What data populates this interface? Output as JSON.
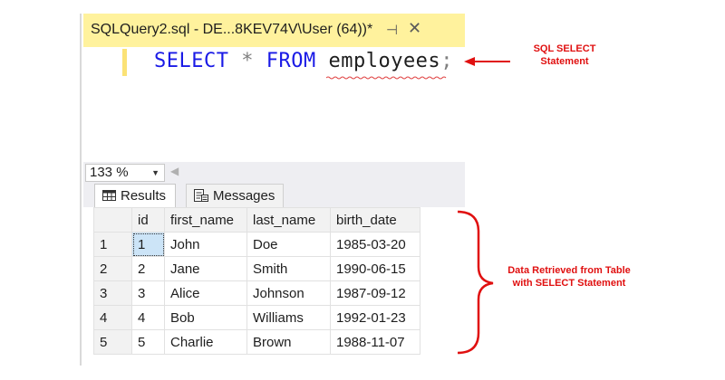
{
  "window": {
    "tab_title": "SQLQuery2.sql - DE...8KEV74V\\User (64))*",
    "pin_glyph": "⊣",
    "close_glyph": "✕"
  },
  "editor": {
    "kw_select": "SELECT",
    "star": "*",
    "kw_from": "FROM",
    "table": "employees",
    "semicolon": ";"
  },
  "zoom": {
    "value": "133 %"
  },
  "result_tabs": {
    "results": "Results",
    "messages": "Messages"
  },
  "grid": {
    "columns": [
      "id",
      "first_name",
      "last_name",
      "birth_date"
    ],
    "rows": [
      {
        "num": "1",
        "id": "1",
        "first_name": "John",
        "last_name": "Doe",
        "birth_date": "1985-03-20"
      },
      {
        "num": "2",
        "id": "2",
        "first_name": "Jane",
        "last_name": "Smith",
        "birth_date": "1990-06-15"
      },
      {
        "num": "3",
        "id": "3",
        "first_name": "Alice",
        "last_name": "Johnson",
        "birth_date": "1987-09-12"
      },
      {
        "num": "4",
        "id": "4",
        "first_name": "Bob",
        "last_name": "Williams",
        "birth_date": "1992-01-23"
      },
      {
        "num": "5",
        "id": "5",
        "first_name": "Charlie",
        "last_name": "Brown",
        "birth_date": "1988-11-07"
      }
    ]
  },
  "annotations": {
    "select_line1": "SQL SELECT",
    "select_line2": "Statement",
    "data_line1": "Data Retrieved from Table",
    "data_line2": "with SELECT Statement"
  },
  "colors": {
    "tab_bg": "#fff29d",
    "keyword": "#1a1ae6",
    "annotation": "#e01010",
    "selected_cell": "#cce4f7"
  }
}
